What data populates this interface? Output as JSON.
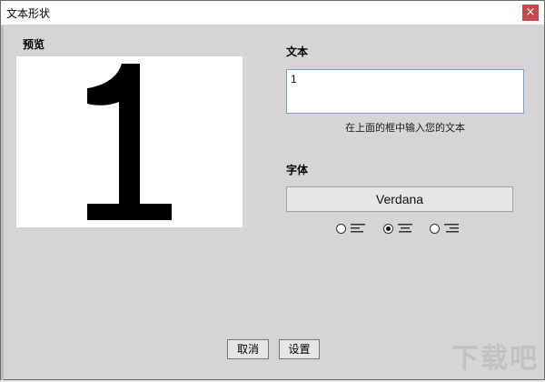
{
  "window": {
    "title": "文本形状",
    "close_label": "×"
  },
  "preview": {
    "label": "预览",
    "glyph": "1"
  },
  "text_section": {
    "label": "文本",
    "value": "1",
    "hint": "在上面的框中输入您的文本"
  },
  "font_section": {
    "label": "字体",
    "font_name": "Verdana"
  },
  "alignment": {
    "options": [
      {
        "name": "left",
        "icon": "align-left-icon",
        "selected": false
      },
      {
        "name": "center",
        "icon": "align-center-icon",
        "selected": true
      },
      {
        "name": "right",
        "icon": "align-right-icon",
        "selected": false
      }
    ]
  },
  "buttons": {
    "cancel": "取消",
    "set": "设置"
  },
  "watermark": "下载吧",
  "colors": {
    "close": "#c64a4a",
    "input_border": "#6fa3d6",
    "dialog_bg": "#d6d4d6"
  }
}
